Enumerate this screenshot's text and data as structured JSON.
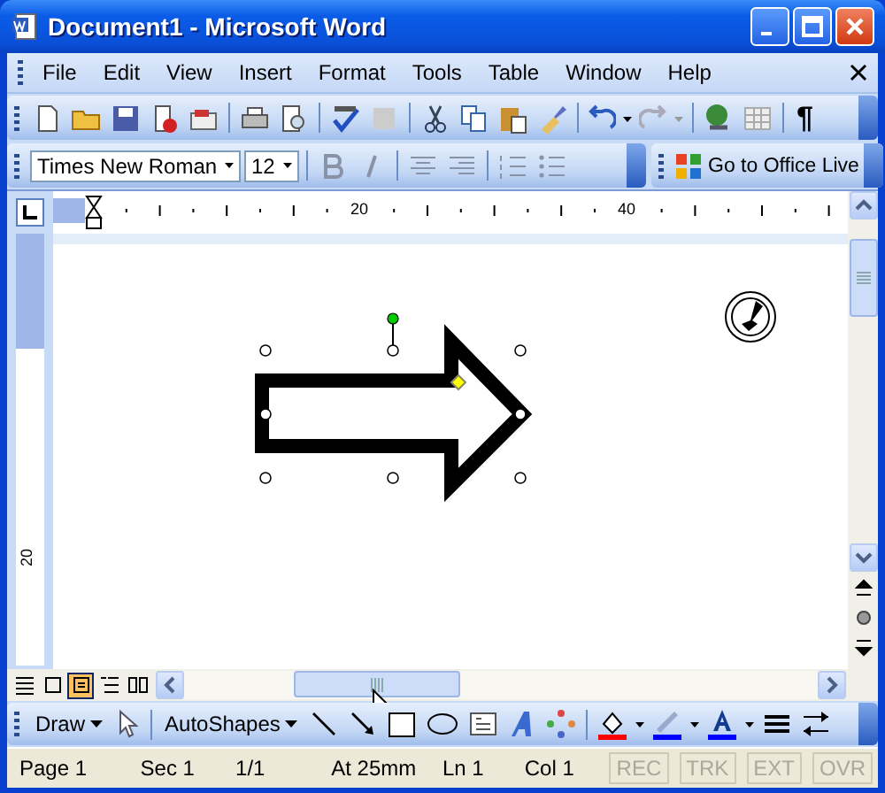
{
  "window": {
    "title": "Document1 - Microsoft Word"
  },
  "menu": [
    "File",
    "Edit",
    "View",
    "Insert",
    "Format",
    "Tools",
    "Table",
    "Window",
    "Help"
  ],
  "standard_toolbar": {
    "show_hide_mark": "¶"
  },
  "formatting_toolbar": {
    "font": "Times New Roman",
    "size": "12",
    "office_live": "Go to Office Live"
  },
  "ruler": {
    "labels": [
      "20",
      "40"
    ],
    "vertical_labels": [
      "20"
    ]
  },
  "view_buttons": [
    {
      "selected": false
    },
    {
      "selected": false
    },
    {
      "selected": true
    },
    {
      "selected": false
    },
    {
      "selected": false
    }
  ],
  "drawing_toolbar": {
    "draw": "Draw",
    "autoshapes": "AutoShapes"
  },
  "status_bar": [
    {
      "text": "Page 1",
      "kind": "info"
    },
    {
      "text": "Sec 1",
      "kind": "info"
    },
    {
      "text": "1/1",
      "kind": "info"
    },
    {
      "text": "At 25mm",
      "kind": "info"
    },
    {
      "text": "Ln 1",
      "kind": "info"
    },
    {
      "text": "Col 1",
      "kind": "info"
    },
    {
      "text": "REC",
      "kind": "mode",
      "disabled": true
    },
    {
      "text": "TRK",
      "kind": "mode",
      "disabled": true
    },
    {
      "text": "EXT",
      "kind": "mode",
      "disabled": true
    },
    {
      "text": "OVR",
      "kind": "mode",
      "disabled": true
    }
  ]
}
